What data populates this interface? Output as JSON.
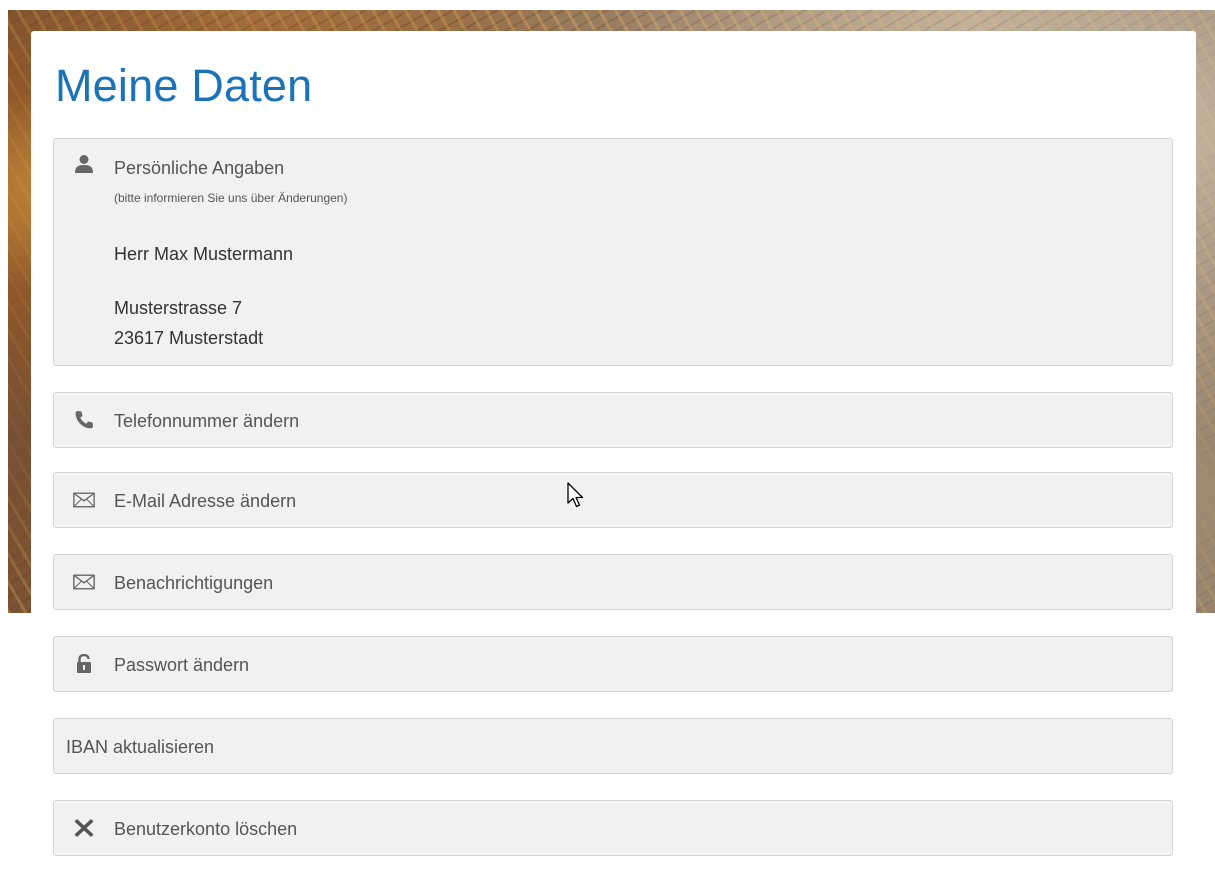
{
  "page": {
    "title": "Meine Daten"
  },
  "personal": {
    "label": "Persönliche Angaben",
    "note": "(bitte informieren Sie uns über Änderungen)",
    "name": "Herr Max Mustermann",
    "street": "Musterstrasse 7",
    "city": "23617 Musterstadt",
    "icon": "user-icon"
  },
  "actions": [
    {
      "label": "Telefonnummer ändern",
      "icon": "phone-icon"
    },
    {
      "label": "E-Mail Adresse ändern",
      "icon": "envelope-icon"
    },
    {
      "label": "Benachrichtigungen",
      "icon": "envelope-icon"
    },
    {
      "label": "Passwort ändern",
      "icon": "lock-icon"
    },
    {
      "label": "IBAN aktualisieren",
      "icon": ""
    },
    {
      "label": "Benutzerkonto löschen",
      "icon": "close-icon"
    }
  ],
  "colors": {
    "title": "#1a73b9",
    "panel_bg": "#f1f1f1",
    "panel_border": "#d3d3d3",
    "text": "#555555"
  }
}
